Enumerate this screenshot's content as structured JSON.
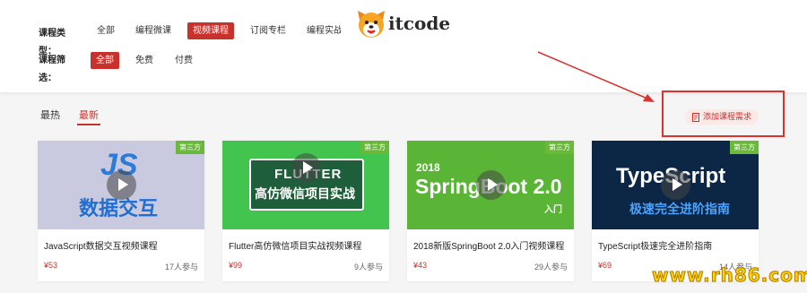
{
  "filters": {
    "category_label": "课程类型：",
    "screen_label": "课程筛选：",
    "category_items": [
      "全部",
      "编程微课",
      "视频课程",
      "订阅专栏",
      "编程实战"
    ],
    "screen_items": [
      "全部",
      "免费",
      "付费"
    ]
  },
  "logo": {
    "text": "itcode"
  },
  "sort_tabs": [
    "最热",
    "最新"
  ],
  "add_request": {
    "label": "添加课程需求"
  },
  "courses": [
    {
      "badge": "第三方",
      "title": "JavaScript数据交互视频课程",
      "price": "¥53",
      "count": "17人参与",
      "thumb_line1": "JS",
      "thumb_line2": "数据交互"
    },
    {
      "badge": "第三方",
      "title": "Flutter高仿微信项目实战视频课程",
      "price": "¥99",
      "count": "9人参与",
      "thumb_line1": "FLUTTER",
      "thumb_line2": "高仿微信项目实战"
    },
    {
      "badge": "第三方",
      "title": "2018新版SpringBoot 2.0入门视频课程",
      "price": "¥43",
      "count": "29人参与",
      "thumb_line1": "2018",
      "thumb_line2": "SpringBoot 2.0",
      "thumb_line3": "入门"
    },
    {
      "badge": "第三方",
      "title": "TypeScript极速完全进阶指南",
      "price": "¥69",
      "count": "14人参与",
      "thumb_line1": "TypeScript",
      "thumb_line2": "极速完全进阶指南"
    }
  ],
  "watermark": "www.rh86.com",
  "colors": {
    "accent": "#c8322d",
    "badge": "#6ab93a",
    "highlight_box": "#d9332e"
  }
}
